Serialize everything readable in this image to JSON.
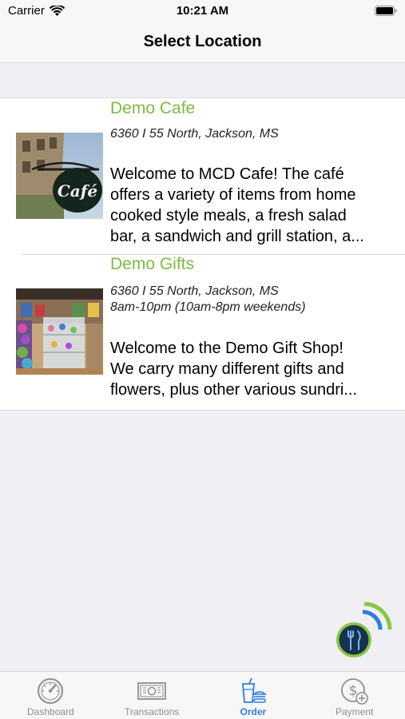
{
  "status_bar": {
    "carrier": "Carrier",
    "time": "10:21 AM"
  },
  "nav": {
    "title": "Select Location"
  },
  "locations": [
    {
      "name": "Demo Cafe",
      "address_lines": [
        "6360 I 55 North, Jackson, MS"
      ],
      "description_lines": [
        "Welcome to MCD Cafe! The café",
        "offers a variety of items from home",
        "cooked style meals, a fresh salad",
        "bar, a sandwich and grill station, a..."
      ],
      "image_sign_text": "Café"
    },
    {
      "name": "Demo Gifts",
      "address_lines": [
        "6360 I 55 North, Jackson, MS",
        "8am-10pm (10am-8pm weekends)"
      ],
      "description_lines": [
        "Welcome to the Demo Gift Shop!",
        "We carry many different gifts and",
        "flowers, plus other various sundri..."
      ]
    }
  ],
  "tabs": [
    {
      "label": "Dashboard",
      "icon": "speedometer-icon",
      "active": false
    },
    {
      "label": "Transactions",
      "icon": "cash-icon",
      "active": false
    },
    {
      "label": "Order",
      "icon": "drink-burger-icon",
      "active": true
    },
    {
      "label": "Payment",
      "icon": "dollar-plus-icon",
      "active": false
    }
  ],
  "colors": {
    "accent_green": "#7dbb42",
    "active_tab_blue": "#2f7de1",
    "inactive_tab_gray": "#8e8e93",
    "fab_fill": "#16324f",
    "fab_ring": "#8cc63f"
  }
}
